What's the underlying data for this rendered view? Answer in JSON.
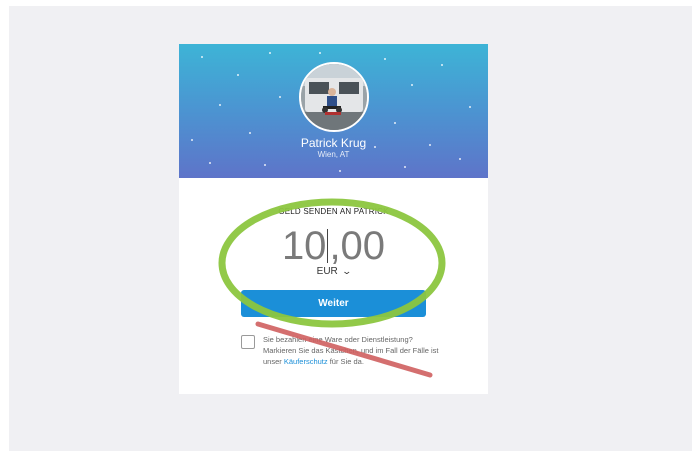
{
  "recipient": {
    "name": "Patrick Krug",
    "location": "Wien, AT"
  },
  "send": {
    "heading": "GELD SENDEN AN PATRICK",
    "amount_whole": "10",
    "amount_decimal": ",00",
    "currency": "EUR",
    "continue_label": "Weiter"
  },
  "purchase_notice": {
    "text_before_link": "Sie bezahlen eine Ware oder Dienstleistung? Markieren Sie das Kästchen, und im Fall der Fälle ist unser ",
    "link_label": "Käuferschutz",
    "text_after_link": " für Sie da."
  },
  "colors": {
    "hero_top": "#3db4d6",
    "hero_bottom": "#5e74c9",
    "button": "#1b8fd8",
    "annotation_ellipse": "#8cc63f",
    "annotation_line": "#d06060"
  },
  "icons": {
    "currency_dropdown": "chevron-down-icon"
  }
}
